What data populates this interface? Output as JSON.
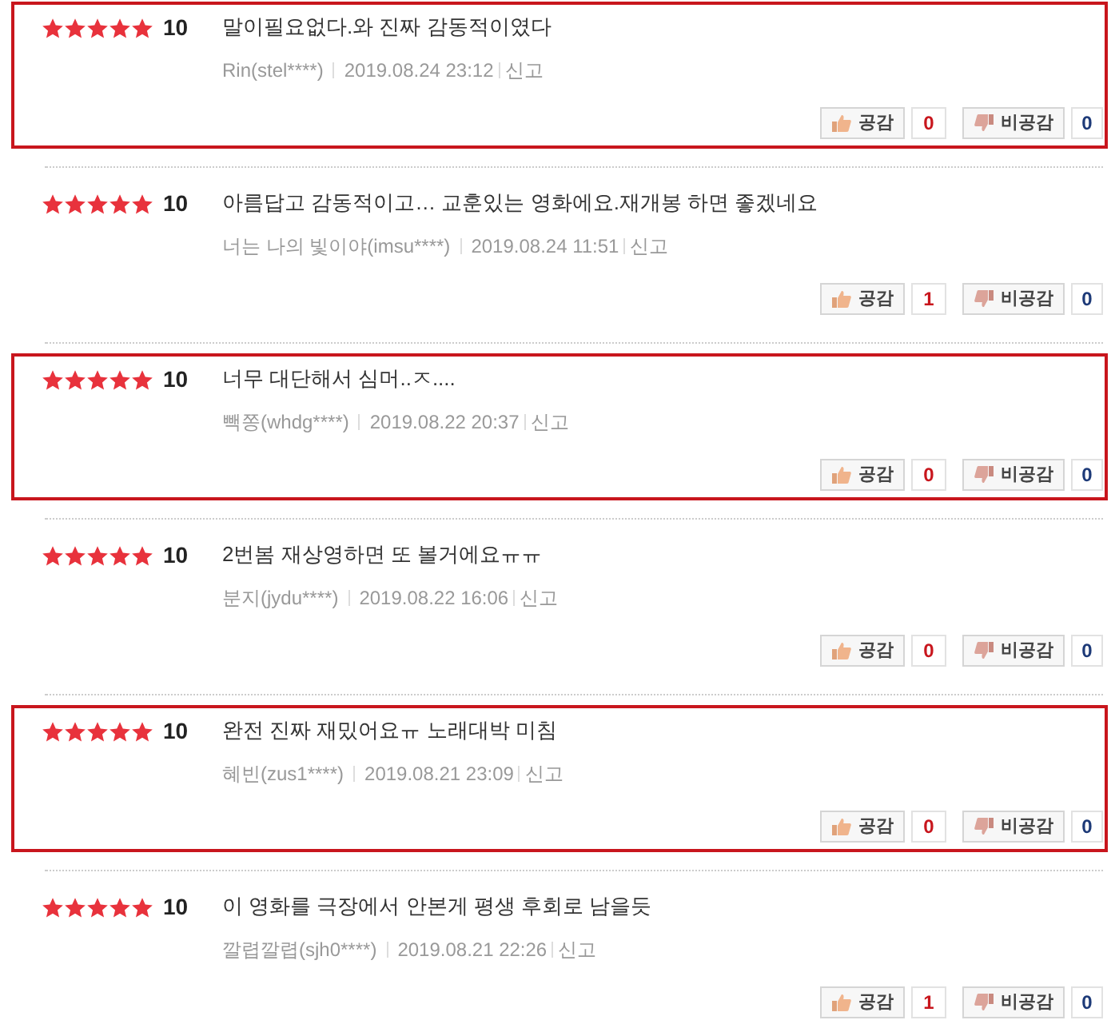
{
  "reviews": [
    {
      "stars": 5,
      "score": "10",
      "text": "말이필요없다.와 진짜 감동적이였다",
      "author": "Rin(stel****)",
      "date": "2019.08.24 23:12",
      "report": "신고",
      "like_label": "공감",
      "likes": "0",
      "dislike_label": "비공감",
      "dislikes": "0",
      "highlighted": true
    },
    {
      "stars": 5,
      "score": "10",
      "text": "아름답고 감동적이고… 교훈있는 영화에요.재개봉 하면 좋겠네요",
      "author": "너는 나의 빛이야(imsu****)",
      "date": "2019.08.24 11:51",
      "report": "신고",
      "like_label": "공감",
      "likes": "1",
      "dislike_label": "비공감",
      "dislikes": "0",
      "highlighted": false
    },
    {
      "stars": 5,
      "score": "10",
      "text": "너무 대단해서 심머..ㅈ....",
      "author": "빽쫑(whdg****)",
      "date": "2019.08.22 20:37",
      "report": "신고",
      "like_label": "공감",
      "likes": "0",
      "dislike_label": "비공감",
      "dislikes": "0",
      "highlighted": true
    },
    {
      "stars": 5,
      "score": "10",
      "text": "2번봄 재상영하면 또 볼거에요ㅠㅠ",
      "author": "분지(jydu****)",
      "date": "2019.08.22 16:06",
      "report": "신고",
      "like_label": "공감",
      "likes": "0",
      "dislike_label": "비공감",
      "dislikes": "0",
      "highlighted": false
    },
    {
      "stars": 5,
      "score": "10",
      "text": "완전 진짜 재밌어요ㅠ 노래대박 미침",
      "author": "혜빈(zus1****)",
      "date": "2019.08.21 23:09",
      "report": "신고",
      "like_label": "공감",
      "likes": "0",
      "dislike_label": "비공감",
      "dislikes": "0",
      "highlighted": true
    },
    {
      "stars": 5,
      "score": "10",
      "text": "이 영화를 극장에서 안본게 평생 후회로 남을듯",
      "author": "깔렵깔렵(sjh0****)",
      "date": "2019.08.21 22:26",
      "report": "신고",
      "like_label": "공감",
      "likes": "1",
      "dislike_label": "비공감",
      "dislikes": "0",
      "highlighted": false
    }
  ]
}
